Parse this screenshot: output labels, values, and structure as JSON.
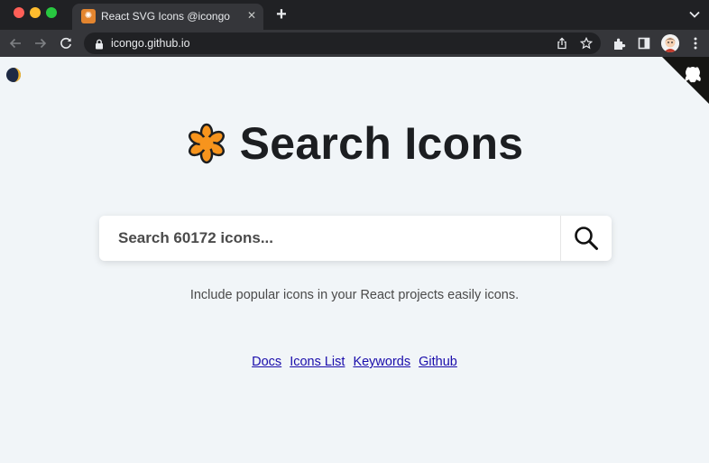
{
  "browser": {
    "tab": {
      "title": "React SVG Icons @icongo",
      "close_glyph": "✕"
    },
    "new_tab_glyph": "+",
    "address_bar": {
      "url": "icongo.github.io"
    },
    "icons": [
      "back-icon",
      "forward-icon",
      "reload-icon",
      "lock-icon",
      "share-icon",
      "bookmark-star-icon",
      "extensions-icon",
      "sidebar-icon",
      "profile-avatar",
      "more-menu-icon"
    ]
  },
  "page": {
    "title": "Search Icons",
    "search": {
      "placeholder": "Search 60172 icons...",
      "value": ""
    },
    "tagline": "Include popular icons in your React projects easily icons.",
    "links": [
      {
        "label": "Docs"
      },
      {
        "label": "Icons List"
      },
      {
        "label": "Keywords"
      },
      {
        "label": "Github"
      }
    ]
  },
  "colors": {
    "page_background": "#f1f5f8",
    "logo_orange": "#f7941d",
    "title_text": "#1c1e21",
    "link": "#1a0dab"
  }
}
